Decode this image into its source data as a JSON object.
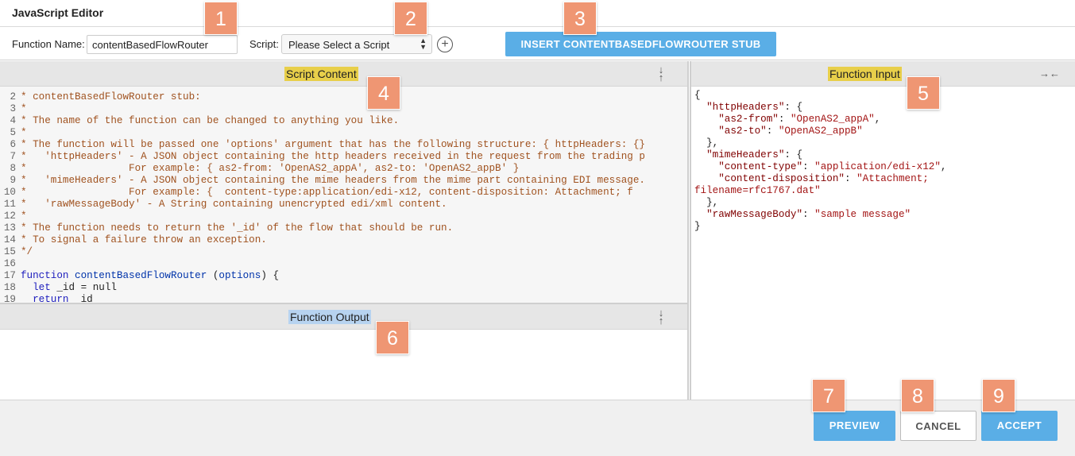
{
  "window": {
    "title": "JavaScript Editor"
  },
  "toolbar": {
    "function_name_label": "Function Name:",
    "function_name_value": "contentBasedFlowRouter",
    "script_label": "Script:",
    "script_selected": "Please Select a Script",
    "add_script_icon": "plus-circle-icon",
    "insert_button": "INSERT CONTENTBASEDFLOWROUTER STUB"
  },
  "script_panel": {
    "title": "Script Content",
    "collapse_icon": "collapse-vertical-icon",
    "lines": [
      {
        "n": "",
        "kind": "comment",
        "text": ""
      },
      {
        "n": "2",
        "kind": "comment",
        "text": "* contentBasedFlowRouter stub:"
      },
      {
        "n": "3",
        "kind": "comment",
        "text": "*"
      },
      {
        "n": "4",
        "kind": "comment",
        "text": "* The name of the function can be changed to anything you like."
      },
      {
        "n": "5",
        "kind": "comment",
        "text": "*"
      },
      {
        "n": "6",
        "kind": "comment",
        "text": "* The function will be passed one 'options' argument that has the following structure: { httpHeaders: {}"
      },
      {
        "n": "7",
        "kind": "comment",
        "text": "*   'httpHeaders' - A JSON object containing the http headers received in the request from the trading p"
      },
      {
        "n": "8",
        "kind": "comment",
        "text": "*                 For example: { as2-from: 'OpenAS2_appA', as2-to: 'OpenAS2_appB' }"
      },
      {
        "n": "9",
        "kind": "comment",
        "text": "*   'mimeHeaders' - A JSON object containing the mime headers from the mime part containing EDI message."
      },
      {
        "n": "10",
        "kind": "comment",
        "text": "*                 For example: {  content-type:application/edi-x12, content-disposition: Attachment; f"
      },
      {
        "n": "11",
        "kind": "comment",
        "text": "*   'rawMessageBody' - A String containing unencrypted edi/xml content."
      },
      {
        "n": "12",
        "kind": "comment",
        "text": "*"
      },
      {
        "n": "13",
        "kind": "comment",
        "text": "* The function needs to return the '_id' of the flow that should be run."
      },
      {
        "n": "14",
        "kind": "comment",
        "text": "* To signal a failure throw an exception."
      },
      {
        "n": "15",
        "kind": "comment",
        "text": "*/"
      },
      {
        "n": "16",
        "kind": "plain",
        "text": ""
      },
      {
        "n": "17",
        "kind": "fn",
        "kw": "function",
        "name": "contentBasedFlowRouter",
        "rest1": " (",
        "param": "options",
        "rest2": ") {"
      },
      {
        "n": "18",
        "kind": "let",
        "kw": "  let",
        "rest": " _id = null"
      },
      {
        "n": "19",
        "kind": "ret",
        "kw": "  return",
        "rest": " _id"
      }
    ]
  },
  "input_panel": {
    "title": "Function Input",
    "collapse_icon": "collapse-horizontal-icon",
    "lines": [
      {
        "text": "{"
      },
      {
        "indent": "  ",
        "key": "\"httpHeaders\"",
        "sep": ": {"
      },
      {
        "indent": "    ",
        "key": "\"as2-from\"",
        "sep": ": ",
        "val": "\"OpenAS2_appA\"",
        "end": ","
      },
      {
        "indent": "    ",
        "key": "\"as2-to\"",
        "sep": ": ",
        "val": "\"OpenAS2_appB\""
      },
      {
        "text": "  },"
      },
      {
        "indent": "  ",
        "key": "\"mimeHeaders\"",
        "sep": ": {"
      },
      {
        "indent": "    ",
        "key": "\"content-type\"",
        "sep": ": ",
        "val": "\"application/edi-x12\"",
        "end": ","
      },
      {
        "indent": "    ",
        "key": "\"content-disposition\"",
        "sep": ": ",
        "val": "\"Attachment;"
      },
      {
        "val": "filename=rfc1767.dat\""
      },
      {
        "text": "  },"
      },
      {
        "indent": "  ",
        "key": "\"rawMessageBody\"",
        "sep": ": ",
        "val": "\"sample message\""
      },
      {
        "text": "}"
      }
    ]
  },
  "output_panel": {
    "title": "Function Output",
    "collapse_icon": "collapse-vertical-icon"
  },
  "footer": {
    "preview": "PREVIEW",
    "cancel": "CANCEL",
    "accept": "ACCEPT"
  },
  "callouts": [
    "1",
    "2",
    "3",
    "4",
    "5",
    "6",
    "7",
    "8",
    "9"
  ],
  "colors": {
    "accent": "#5aaee6",
    "callout": "#ef9673",
    "highlight_yellow": "#e8cf4a",
    "highlight_blue": "#b7d3f0"
  }
}
